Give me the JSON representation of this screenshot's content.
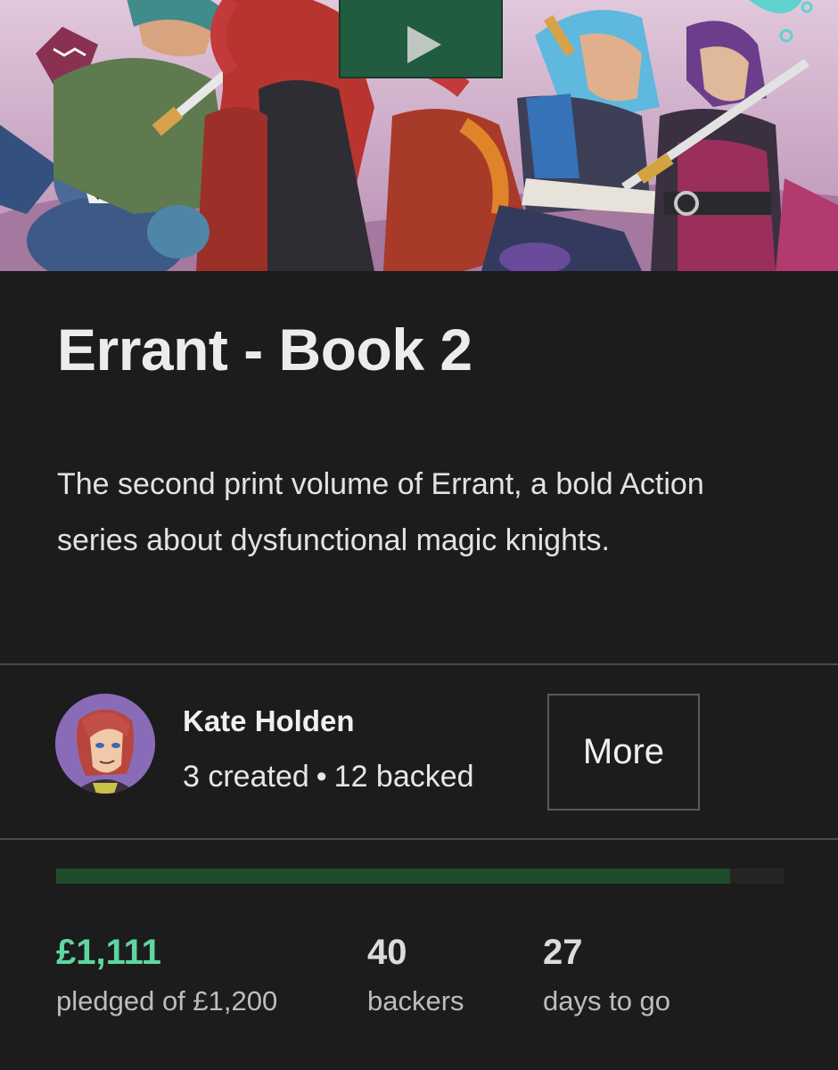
{
  "video": {
    "play_icon": "play-icon",
    "accent": "#215c41"
  },
  "project": {
    "title": "Errant - Book 2",
    "blurb": "The second print volume of Errant, a bold Action series about dysfunctional magic knights."
  },
  "creator": {
    "name": "Kate Holden",
    "created": "3 created",
    "separator": "•",
    "backed": "12 backed",
    "more_label": "More"
  },
  "funding": {
    "progress_fraction": 0.926,
    "fill_color": "#1f4d2b",
    "pledged": "£1,111",
    "pledged_label": "pledged of £1,200",
    "pledged_color": "#5fd6a0",
    "backers": "40",
    "backers_label": "backers",
    "days": "27",
    "days_label": "days to go"
  }
}
